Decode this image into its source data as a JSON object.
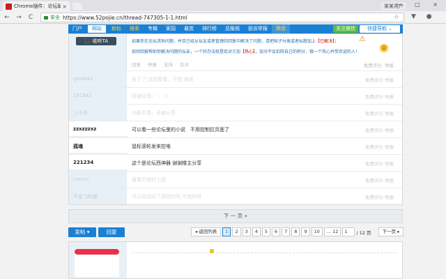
{
  "browser": {
    "tab_title": "Chrome插件：论坛助手…",
    "tab_close": "×",
    "profile": "某某用户",
    "url_secure": "安全",
    "url": "https://www.52pojie.cn/thread-747305-1-1.html",
    "nav_back": "←",
    "nav_forward": "→",
    "nav_reload": "C",
    "nav_home": "⌂",
    "star": "☆",
    "ext_icons": "▼ ●",
    "window_controls": "— ▢ ×"
  },
  "sitenav": {
    "items": [
      "门户",
      "网站",
      "新帖",
      "搜索",
      "专辑",
      "家园",
      "悬赏",
      "排行榜",
      "总版规",
      "投诉举报",
      "腾盘"
    ],
    "wechat": "关注微信",
    "quicknav": "快捷导航 ⌄"
  },
  "first_post": {
    "listen_icon": "🎧",
    "listen_label": "收听TA",
    "notice_a": "如果你在论坛求助问题，并且已经从坛友或者管理的回复中解决了问题，请把帖子分类或者标题加上",
    "notice_a_tag": "【已解决】",
    "notice_a_end": "；",
    "notice_b": "如何回报帮助你解决问题的坛友，一个好办法就是给对方加",
    "notice_b_hot": "【热心】",
    "notice_b_end": "，加分不会扣除自己的积分，做一个热心并受欢迎的人！",
    "emoji1": "⚠",
    "emoji2": "😮",
    "actions": [
      "回复",
      "举报",
      "支持",
      "反对"
    ],
    "links": [
      "免费评分",
      "举报"
    ]
  },
  "replies": [
    {
      "user": "ginob91",
      "msg": "收下了 试用看看，不错 谢谢",
      "links": "免费评分  举报",
      "strong": false,
      "dark": false,
      "hl": false
    },
    {
      "user": "161542",
      "msg": "感谢分享(＾-＾)/",
      "links": "免费评分  举报",
      "strong": false,
      "dark": false,
      "hl": false
    },
    {
      "user": "上不去",
      "msg": "功能不错，多谢分享",
      "links": "免费评分  举报",
      "strong": false,
      "dark": false,
      "hl": false
    },
    {
      "user": "zzxzzzxz",
      "msg": "可以看一些论坛里的小说　不用控制拉页面了",
      "links": "免费评分  举报",
      "strong": true,
      "dark": true,
      "hl": true
    },
    {
      "user": "孤魂",
      "msg": "鼠标滚轮发来控电",
      "links": "免费评分  举报",
      "strong": true,
      "dark": true,
      "hl": true
    },
    {
      "user": "221234",
      "msg": "这个是论坛西神器 谢谢楼主分享",
      "links": "免费评分  举报",
      "strong": true,
      "dark": true,
      "hl": true
    },
    {
      "user": "cacrcx",
      "msg": "看看不错的工具",
      "links": "免费评分  举报",
      "strong": false,
      "dark": false,
      "hl": false
    },
    {
      "user": "不会飞的猫",
      "msg": "可以自动向下滚动的吗 不错的呀",
      "links": "免费评分  举报",
      "strong": false,
      "dark": false,
      "hl": false
    }
  ],
  "nextpage": "下 一 页  »",
  "controls": {
    "post": "发帖 ▾",
    "reply": "回复"
  },
  "pager": {
    "back": "◂ 返回列表",
    "pages": [
      "1",
      "2",
      "3",
      "4",
      "5",
      "6",
      "7",
      "8",
      "9",
      "10",
      "... 12"
    ],
    "current": "1",
    "input": "1",
    "total": "/ 12 页",
    "next": "下一页 ▸"
  }
}
